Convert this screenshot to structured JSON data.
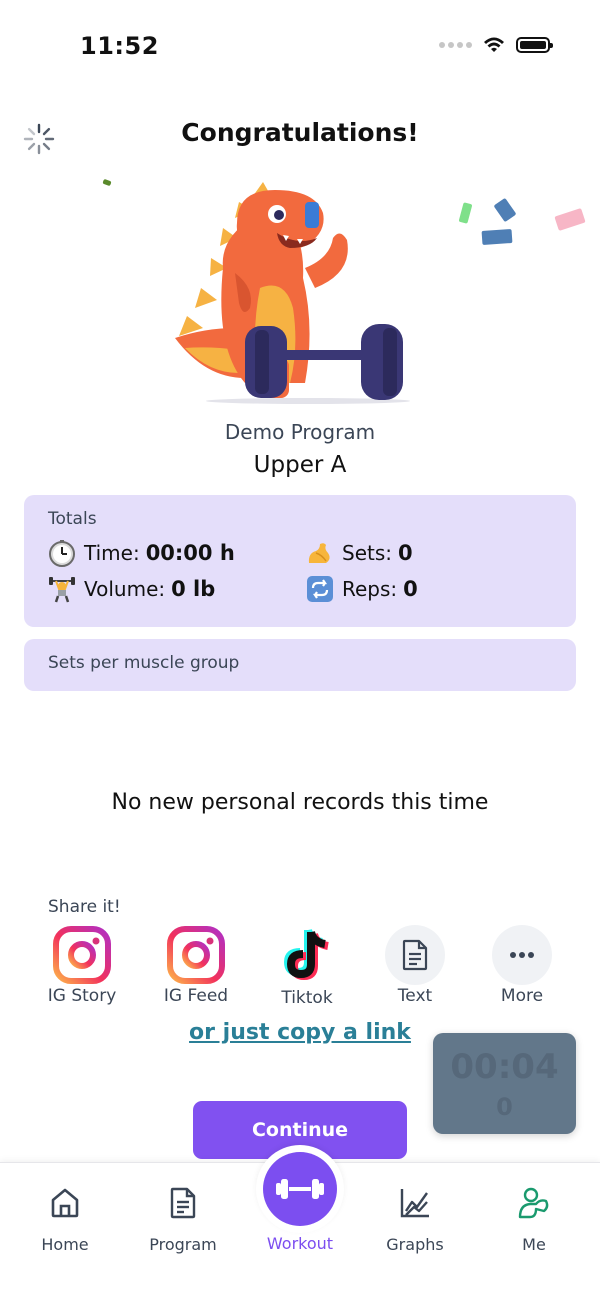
{
  "status_bar": {
    "time": "11:52"
  },
  "header": {
    "title": "Congratulations!"
  },
  "workout": {
    "program": "Demo Program",
    "name": "Upper A"
  },
  "totals": {
    "label": "Totals",
    "time_label": "Time:",
    "time_value": "00:00 h",
    "sets_label": "Sets:",
    "sets_value": "0",
    "volume_label": "Volume:",
    "volume_value": "0 lb",
    "reps_label": "Reps:",
    "reps_value": "0"
  },
  "muscle_group": {
    "label": "Sets per muscle group"
  },
  "records": {
    "message": "No new personal records this time"
  },
  "share": {
    "label": "Share it!",
    "items": [
      {
        "label": "IG Story",
        "icon": "instagram-icon"
      },
      {
        "label": "IG Feed",
        "icon": "instagram-icon"
      },
      {
        "label": "Tiktok",
        "icon": "tiktok-icon"
      },
      {
        "label": "Text",
        "icon": "document-icon"
      },
      {
        "label": "More",
        "icon": "more-icon"
      }
    ],
    "copy_link": "or just copy a link"
  },
  "timer": {
    "time": "00:04",
    "sub": "0"
  },
  "actions": {
    "continue_label": "Continue"
  },
  "tabbar": {
    "home": "Home",
    "program": "Program",
    "workout": "Workout",
    "graphs": "Graphs",
    "me": "Me"
  },
  "colors": {
    "accent": "#7c4ef0",
    "card_bg": "#e4defa",
    "link": "#2a7f97",
    "me_tab": "#1a9a6e"
  }
}
